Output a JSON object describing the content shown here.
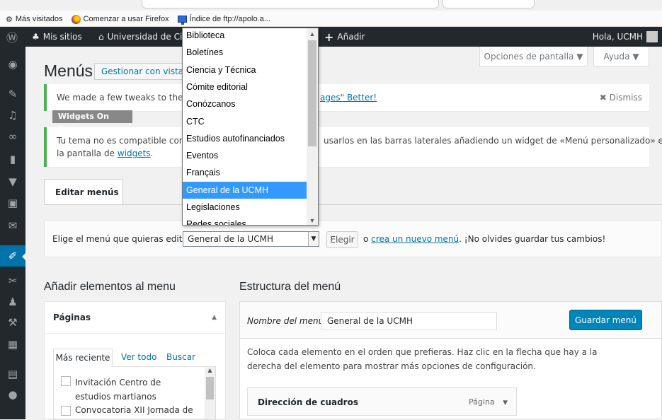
{
  "browser": {
    "bookmarks": [
      {
        "label": "Más visitados",
        "icon": "gear-icon"
      },
      {
        "label": "Comenzar a usar Firefox",
        "icon": "firefox-icon"
      },
      {
        "label": "Índice de ftp://apolo.a...",
        "icon": "monitor-icon"
      }
    ]
  },
  "adminbar": {
    "mis_sitios": "Mis sitios",
    "site_name": "Universidad de Ci",
    "add": "Añadir",
    "greeting": "Hola, UCMH"
  },
  "screen_meta": {
    "options": "Opciones de pantalla ▼",
    "help": "Ayuda ▼"
  },
  "page": {
    "title": "Menús",
    "live_preview": "Gestionar con vista previa"
  },
  "notices": {
    "plugin_pre": "We made a few tweaks to the plu",
    "plugin_link": "ages\" Better!",
    "dismiss": "Dismiss",
    "tag": "Widgets On Pages",
    "theme_line1_pre": "Tu tema no es compatible con m",
    "theme_line1_post": "usarlos en las barras laterales añadiendo un widget de «Menú personalizado» en",
    "theme_line2_pre": "la pantalla de",
    "theme_link": "widgets",
    "theme_line2_post": "."
  },
  "tabs": {
    "edit_menus": "Editar menús"
  },
  "manage": {
    "label": "Elige el menú que quieras editar:",
    "selected": "General de la UCMH",
    "choose": "Elegir",
    "or": "o",
    "create_link": "crea un nuevo menú",
    "reminder": ". ¡No olvides guardar tus cambios!"
  },
  "add_items": {
    "heading": "Añadir elementos al menu",
    "box_title": "Páginas",
    "tab_recent": "Más reciente",
    "tab_all": "Ver todo",
    "tab_search": "Buscar",
    "items": [
      {
        "label": "Invitación Centro de estudios martianos"
      },
      {
        "label": "Convocatoria XII Jornada de"
      }
    ]
  },
  "structure": {
    "heading": "Estructura del menú",
    "name_label": "Nombre del menú",
    "name_value": "General de la UCMH",
    "save": "Guardar menú",
    "description": "Coloca cada elemento en el orden que prefieras. Haz clic en la flecha que hay a la derecha del elemento para mostrar más opciones de configuración.",
    "item_title": "Dirección de cuadros",
    "item_type": "Página"
  },
  "dropdown": {
    "options": [
      "Biblioteca",
      "Boletínes",
      "Ciencia y Técnica",
      "Cómite editorial",
      "Conózcanos",
      "CTC",
      "Estudios autofinanciados",
      "Eventos",
      "Français",
      "General de la UCMH",
      "Legislaciones",
      "Redes sociales"
    ],
    "selected": "General de la UCMH"
  },
  "colors": {
    "admin_dark": "#23282d",
    "accent": "#0073aa",
    "primary_button": "#0085ba",
    "notice_green": "#46b450",
    "dropdown_highlight": "#3399ff"
  }
}
